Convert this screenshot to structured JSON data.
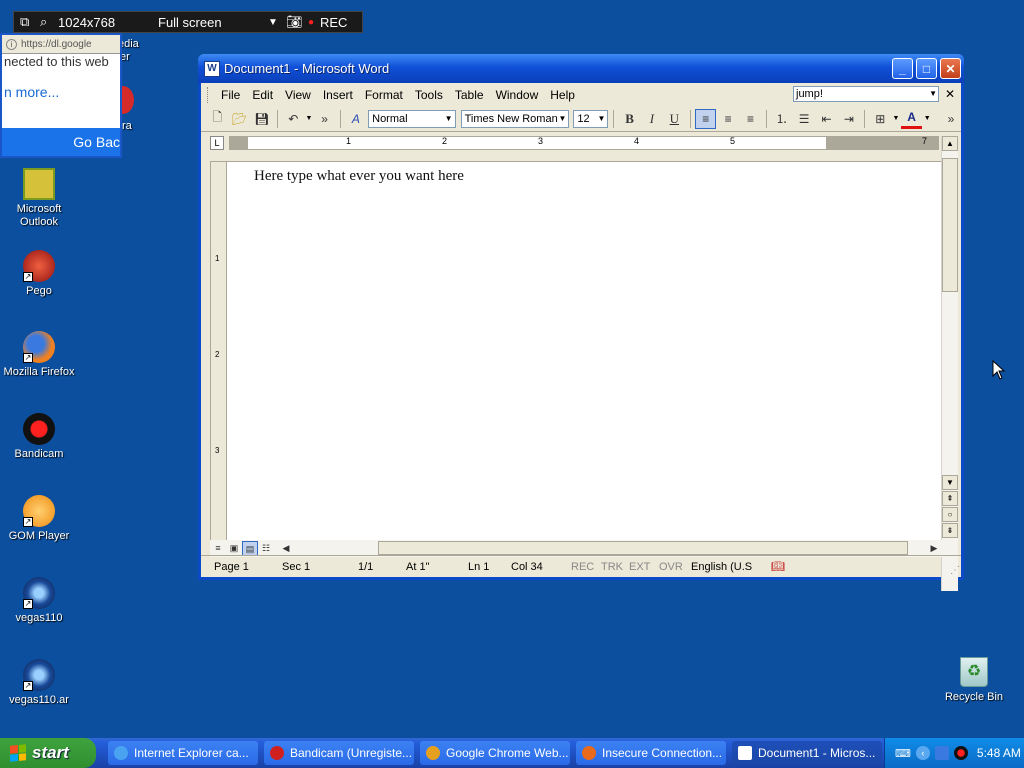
{
  "bandicam_bar": {
    "resolution": "1024x768",
    "mode": "Full screen",
    "rec_label": "REC"
  },
  "ie_popup": {
    "address": "https://dl.google",
    "partial_text": "nected to this web",
    "link_text": "n more...",
    "button_text": "Go Bac"
  },
  "desktop_icons": [
    {
      "label": "Microsoft Outlook",
      "icon": "outlook-icon"
    },
    {
      "label": "Pego",
      "icon": "pego-icon"
    },
    {
      "label": "Mozilla Firefox",
      "icon": "firefox-icon"
    },
    {
      "label": "Bandicam",
      "icon": "bandicam-icon"
    },
    {
      "label": "GOM Player",
      "icon": "gom-player-icon"
    },
    {
      "label": "vegas110",
      "icon": "vegas-icon"
    },
    {
      "label": "vegas110.ar",
      "icon": "vegas-icon"
    }
  ],
  "partial_icons": {
    "top1": "edia",
    "top2": "er",
    "top3": "ra"
  },
  "word": {
    "title": "Document1 - Microsoft Word",
    "menu": [
      "File",
      "Edit",
      "View",
      "Insert",
      "Format",
      "Tools",
      "Table",
      "Window",
      "Help"
    ],
    "help_box": "jump!",
    "toolbar": {
      "style": "Normal",
      "font": "Times New Roman",
      "size": "12",
      "bold": "B",
      "italic": "I",
      "underline": "U"
    },
    "ruler_numbers": [
      "1",
      "2",
      "3",
      "4",
      "5",
      "7"
    ],
    "vruler_numbers": [
      "1",
      "2",
      "3"
    ],
    "document_text": "Here type what ever you want here",
    "status": {
      "page": "Page  1",
      "sec": "Sec  1",
      "pages": "1/1",
      "at": "At  1\"",
      "ln": "Ln  1",
      "col": "Col  34",
      "rec": "REC",
      "trk": "TRK",
      "ext": "EXT",
      "ovr": "OVR",
      "lang": "English (U.S"
    }
  },
  "recycle_bin": "Recycle Bin",
  "taskbar": {
    "start": "start",
    "tasks": [
      {
        "label": "Internet Explorer ca...",
        "color": "#4aa3f0"
      },
      {
        "label": "Bandicam (Unregiste...",
        "color": "#d02020"
      },
      {
        "label": "Google Chrome Web...",
        "color": "#e5a020"
      },
      {
        "label": "Insecure Connection...",
        "color": "#e86a1a"
      },
      {
        "label": "Document1 - Micros...",
        "color": "#ffffff"
      }
    ],
    "clock": "5:48 AM"
  }
}
